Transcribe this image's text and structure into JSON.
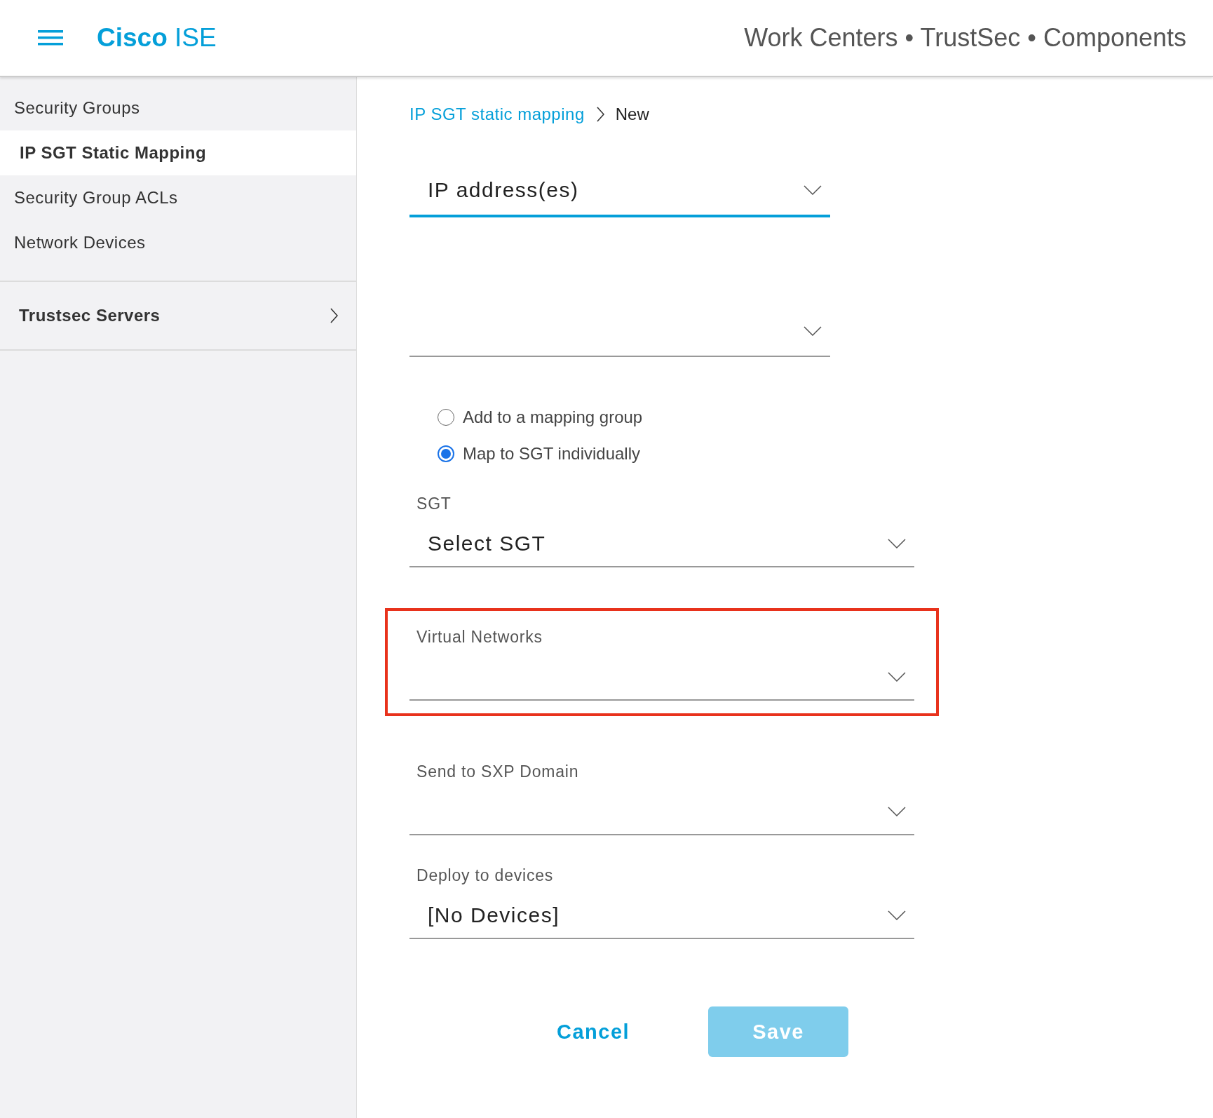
{
  "header": {
    "logo": {
      "brand": "Cisco",
      "product": "ISE"
    },
    "title": "Work Centers • TrustSec • Components"
  },
  "sidebar": {
    "items": [
      {
        "label": "Security Groups",
        "selected": false
      },
      {
        "label": "IP SGT Static Mapping",
        "selected": true
      },
      {
        "label": "Security Group ACLs",
        "selected": false
      },
      {
        "label": "Network Devices",
        "selected": false
      }
    ],
    "sections": [
      {
        "label": "Trustsec Servers",
        "expanded": false
      }
    ]
  },
  "breadcrumb": {
    "link": "IP SGT static mapping",
    "current": "New"
  },
  "form": {
    "fields": [
      {
        "kind": "select",
        "value": "IP address(es)",
        "focused": true
      },
      {
        "kind": "select",
        "focused": false
      },
      {
        "kind": "radios",
        "options": [
          {
            "label": "Add to a mapping group",
            "selected": false
          },
          {
            "label": "Map to SGT individually",
            "selected": true
          }
        ]
      },
      {
        "kind": "select",
        "label": "SGT",
        "value": "Select SGT",
        "focused": false
      },
      {
        "kind": "select",
        "label": "Virtual Networks",
        "focused": false,
        "highlighted": true
      },
      {
        "kind": "select",
        "label": "Send to SXP Domain",
        "focused": false
      },
      {
        "kind": "select",
        "label": "Deploy to devices",
        "value": "[No Devices]",
        "focused": false
      }
    ],
    "buttons": [
      {
        "label": "Cancel",
        "kind": "link"
      },
      {
        "label": "Save",
        "kind": "primary",
        "disabled": true
      }
    ]
  }
}
